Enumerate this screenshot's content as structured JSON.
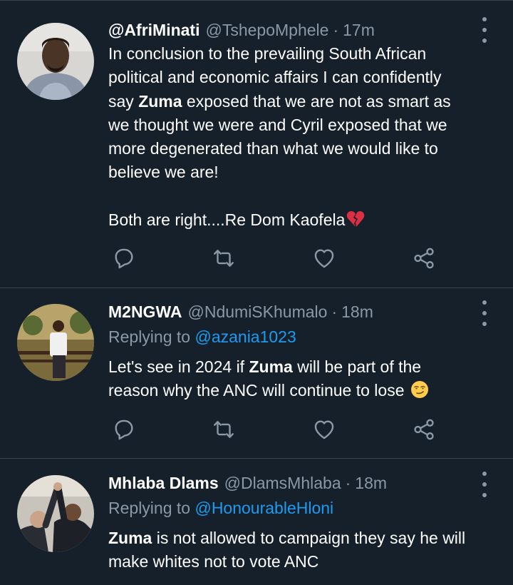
{
  "tweets": [
    {
      "display_name": "@AfriMinati",
      "handle": "@TshepoMphele",
      "time": "17m",
      "body": {
        "l1": "In conclusion to the prevailing South African",
        "l2": "political and economic affairs I can confidently",
        "l3_bold": "Zuma",
        "l3_pre": "say ",
        "l3_post": " exposed that we are not as smart as",
        "l4": "we thought we were and Cyril exposed that we",
        "l5": "more degenerated than what we would like to",
        "l6": "believe we are!",
        "l8": "Both are right....Re Dom Kaofela"
      },
      "emoji": "broken-heart"
    },
    {
      "display_name": "M2NGWA",
      "handle": "@NdumiSKhumalo",
      "time": "18m",
      "replying_label": "Replying to",
      "replying_to": "@azania1023",
      "body": {
        "l1_pre": "Let's see in 2024 if ",
        "l1_bold": "Zuma",
        "l1_post": " will be part of the",
        "l2": "reason why the ANC will continue to lose"
      },
      "emoji": "smirk-face"
    },
    {
      "display_name": "Mhlaba Dlams",
      "handle": "@DlamsMhlaba",
      "time": "18m",
      "replying_label": "Replying to",
      "replying_to": "@HonourableHloni",
      "body": {
        "l1_bold": "Zuma",
        "l1_post": " is not allowed to campaign they say he will",
        "l2": "make whites not to vote ANC"
      }
    }
  ],
  "separator": "·",
  "icons": [
    "reply-icon",
    "retweet-icon",
    "like-icon",
    "share-icon",
    "more-icon"
  ],
  "colors": {
    "background": "#15202b",
    "divider": "#38444d",
    "muted": "#8b98a5",
    "link": "#1d9bf0",
    "text": "#ffffff"
  }
}
